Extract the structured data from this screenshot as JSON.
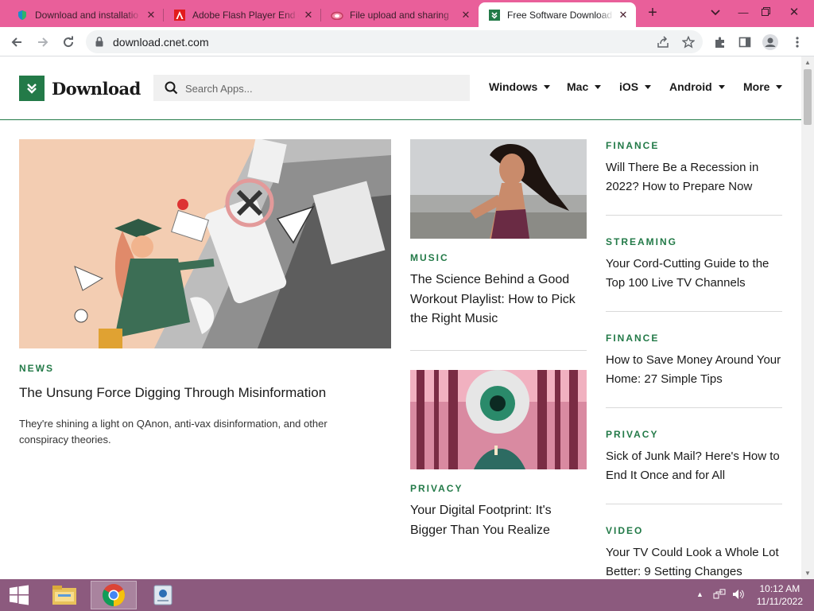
{
  "browser": {
    "tabs": [
      {
        "title": "Download and installatio",
        "icon": "edge-shield-icon"
      },
      {
        "title": "Adobe Flash Player End c",
        "icon": "adobe-icon"
      },
      {
        "title": "File upload and sharing",
        "icon": "cloud-icon"
      },
      {
        "title": "Free Software Download",
        "icon": "download-v-icon",
        "active": true
      }
    ],
    "url": "download.cnet.com",
    "accent": "#e95f9a"
  },
  "site": {
    "logo_text": "Download",
    "search_placeholder": "Search Apps...",
    "nav": [
      "Windows",
      "Mac",
      "iOS",
      "Android",
      "More"
    ],
    "brand_color": "#237a48"
  },
  "feature": {
    "category": "NEWS",
    "headline": "The Unsung Force Digging Through Misinformation",
    "description": "They're shining a light on QAnon, anti-vax disinformation, and other conspiracy theories."
  },
  "middle": [
    {
      "category": "MUSIC",
      "headline": "The Science Behind a Good Workout Playlist: How to Pick the Right Music"
    },
    {
      "category": "PRIVACY",
      "headline": "Your Digital Footprint: It's Bigger Than You Realize"
    }
  ],
  "right": [
    {
      "category": "FINANCE",
      "headline": "Will There Be a Recession in 2022? How to Prepare Now"
    },
    {
      "category": "STREAMING",
      "headline": "Your Cord-Cutting Guide to the Top 100 Live TV Channels"
    },
    {
      "category": "FINANCE",
      "headline": "How to Save Money Around Your Home: 27 Simple Tips"
    },
    {
      "category": "PRIVACY",
      "headline": "Sick of Junk Mail? Here's How to End It Once and for All"
    },
    {
      "category": "VIDEO",
      "headline": "Your TV Could Look a Whole Lot Better: 9 Setting Changes"
    }
  ],
  "taskbar": {
    "time": "10:12 AM",
    "date": "11/11/2022",
    "color": "#8c5a7e"
  }
}
